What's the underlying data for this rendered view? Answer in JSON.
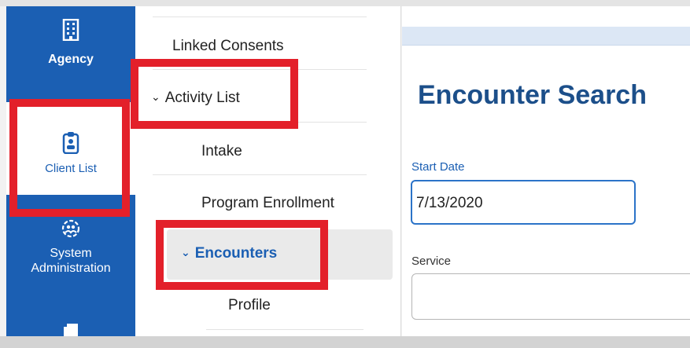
{
  "rail": {
    "agency_label": "Agency",
    "client_list_label": "Client List",
    "system_admin_label_line1": "System",
    "system_admin_label_line2": "Administration",
    "icons": [
      "building-icon",
      "clipboard-icon",
      "gear-users-icon",
      "document-icon"
    ]
  },
  "subnav": {
    "linked_consents": "Linked Consents",
    "activity_list": "Activity List",
    "intake": "Intake",
    "program_enrollment": "Program Enrollment",
    "encounters": "Encounters",
    "profile": "Profile",
    "chevron": "⌄"
  },
  "main": {
    "title": "Encounter Search",
    "start_date_label": "Start Date",
    "start_date_value": "7/13/2020",
    "service_label": "Service",
    "service_value": ""
  },
  "colors": {
    "rail": "#1b5fb3",
    "title": "#1c4f8a",
    "highlight": "#e3202a"
  }
}
